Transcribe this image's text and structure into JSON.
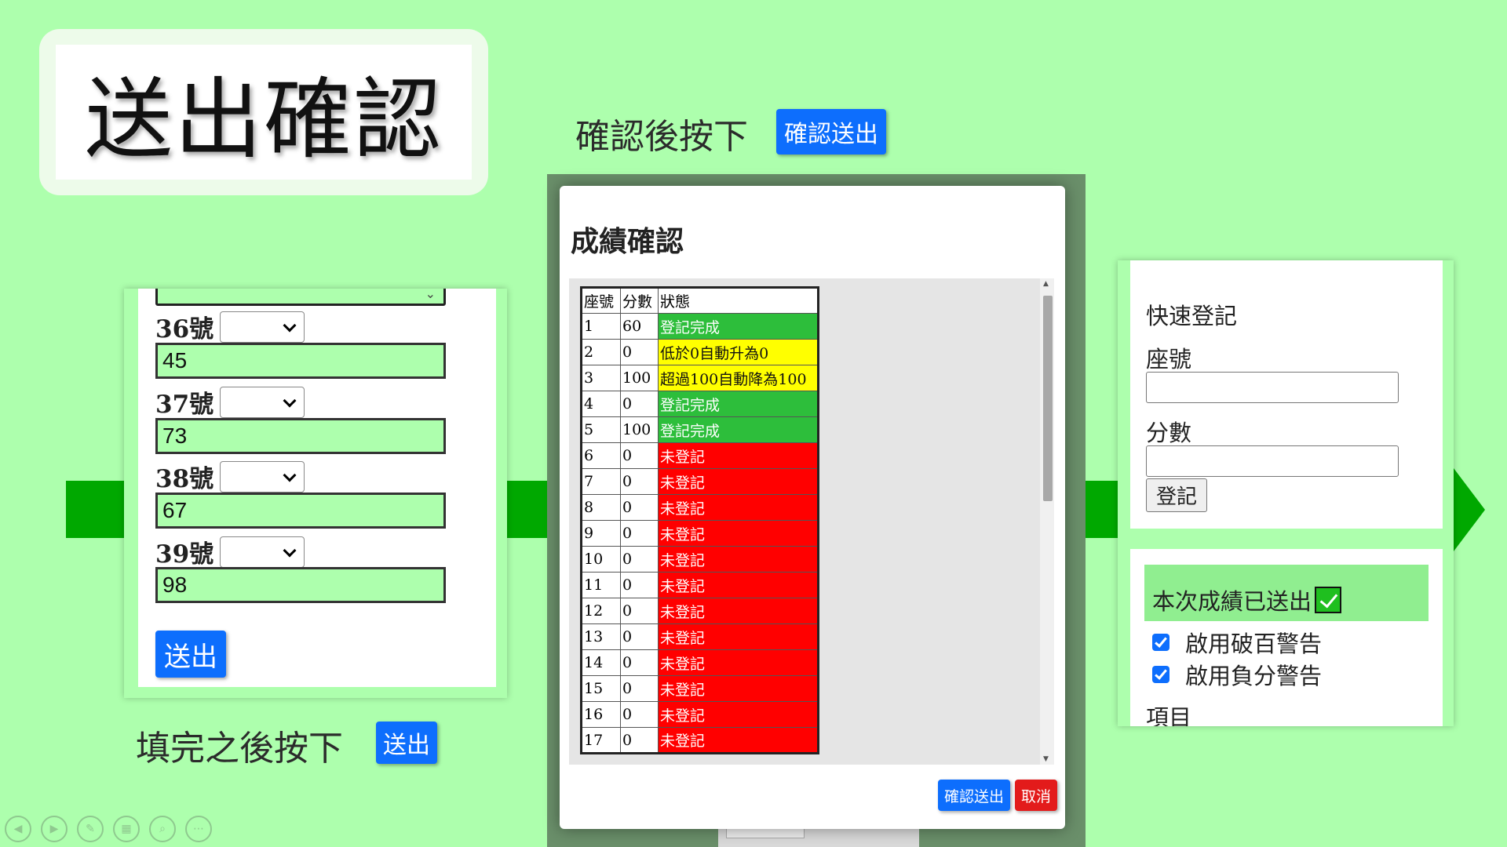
{
  "title": "送出確認",
  "caption_top": "確認後按下",
  "caption_top_button": "確認送出",
  "caption_bottom": "填完之後按下",
  "caption_bottom_button": "送出",
  "left_form": {
    "rows": [
      {
        "label": "36號",
        "value": "45"
      },
      {
        "label": "37號",
        "value": "73"
      },
      {
        "label": "38號",
        "value": "67"
      },
      {
        "label": "39號",
        "value": "98"
      }
    ],
    "send_label": "送出"
  },
  "modal": {
    "title": "成績確認",
    "headers": [
      "座號",
      "分數",
      "狀態"
    ],
    "rows": [
      {
        "seat": "1",
        "score": "60",
        "status": "登記完成",
        "color": "#2dbe3b"
      },
      {
        "seat": "2",
        "score": "0",
        "status": "低於0自動升為0",
        "color": "#ffff00"
      },
      {
        "seat": "3",
        "score": "100",
        "status": "超過100自動降為100",
        "color": "#ffff00"
      },
      {
        "seat": "4",
        "score": "0",
        "status": "登記完成",
        "color": "#2dbe3b"
      },
      {
        "seat": "5",
        "score": "100",
        "status": "登記完成",
        "color": "#2dbe3b"
      },
      {
        "seat": "6",
        "score": "0",
        "status": "未登記",
        "color": "#ff0000"
      },
      {
        "seat": "7",
        "score": "0",
        "status": "未登記",
        "color": "#ff0000"
      },
      {
        "seat": "8",
        "score": "0",
        "status": "未登記",
        "color": "#ff0000"
      },
      {
        "seat": "9",
        "score": "0",
        "status": "未登記",
        "color": "#ff0000"
      },
      {
        "seat": "10",
        "score": "0",
        "status": "未登記",
        "color": "#ff0000"
      },
      {
        "seat": "11",
        "score": "0",
        "status": "未登記",
        "color": "#ff0000"
      },
      {
        "seat": "12",
        "score": "0",
        "status": "未登記",
        "color": "#ff0000"
      },
      {
        "seat": "13",
        "score": "0",
        "status": "未登記",
        "color": "#ff0000"
      },
      {
        "seat": "14",
        "score": "0",
        "status": "未登記",
        "color": "#ff0000"
      },
      {
        "seat": "15",
        "score": "0",
        "status": "未登記",
        "color": "#ff0000"
      },
      {
        "seat": "16",
        "score": "0",
        "status": "未登記",
        "color": "#ff0000"
      },
      {
        "seat": "17",
        "score": "0",
        "status": "未登記",
        "color": "#ff0000"
      }
    ],
    "confirm_label": "確認送出",
    "cancel_label": "取消"
  },
  "quick": {
    "title": "快速登記",
    "seat_label": "座號",
    "score_label": "分數",
    "register_label": "登記",
    "status_text": "本次成績已送出",
    "option1": "啟用破百警告",
    "option2": "啟用負分警告",
    "items_label": "項目"
  },
  "colors": {
    "background": "#adffad",
    "accent": "#0d6efd",
    "arrow": "#00a800"
  }
}
